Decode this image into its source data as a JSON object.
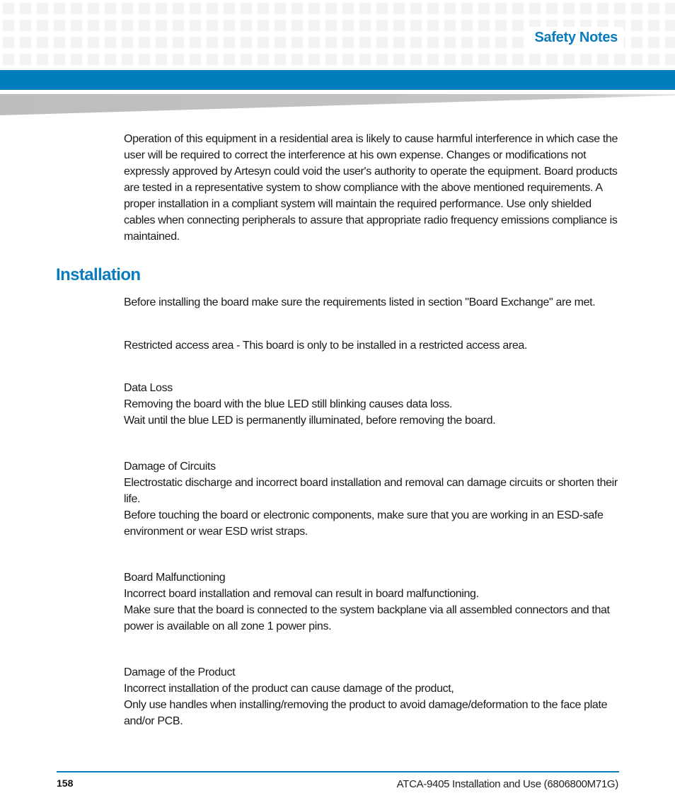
{
  "header": {
    "section_title": "Safety Notes",
    "brand_color": "#007dbd",
    "accent_grey": "#bfc0c2"
  },
  "intro": {
    "paragraph": "Operation of this equipment in a residential area is likely to cause harmful interference in which case the user will be required to correct the interference at his own expense. Changes or modifications not expressly approved by Artesyn could void the user's authority to operate the equipment. Board products are tested in a representative system to show compliance with the above mentioned requirements. A proper installation in a compliant system will maintain the required performance. Use only shielded cables when connecting peripherals to assure that appropriate radio frequency emissions compliance is maintained."
  },
  "installation": {
    "heading": "Installation",
    "paragraphs": [
      "Before installing the board make sure the requirements listed in section \"Board Exchange\" are met.",
      "Restricted access area - This board is only to be installed in a restricted access area."
    ],
    "notices": [
      {
        "title": "Data Loss",
        "lines": [
          "Removing the board with the blue LED still blinking causes data loss.",
          "Wait until the blue LED is permanently illuminated, before removing the board."
        ]
      },
      {
        "title": "Damage of Circuits",
        "lines": [
          "Electrostatic discharge and incorrect board installation and removal can damage circuits or shorten their life.",
          "Before touching the board or electronic components, make sure that you are working in an ESD-safe environment or wear ESD wrist straps."
        ]
      },
      {
        "title": "Board Malfunctioning",
        "lines": [
          "Incorrect board installation and removal can result in board malfunctioning.",
          "Make sure that the board is connected to the system backplane via all assembled connectors and that power is available on all zone 1 power pins."
        ]
      },
      {
        "title": "Damage of the Product",
        "lines": [
          "Incorrect installation of the product can cause damage of the product,",
          "Only use handles when installing/removing the product to avoid damage/deformation to the face plate and/or PCB."
        ]
      }
    ]
  },
  "footer": {
    "page_number": "158",
    "document_title": "ATCA-9405 Installation and Use (6806800M71G)"
  }
}
